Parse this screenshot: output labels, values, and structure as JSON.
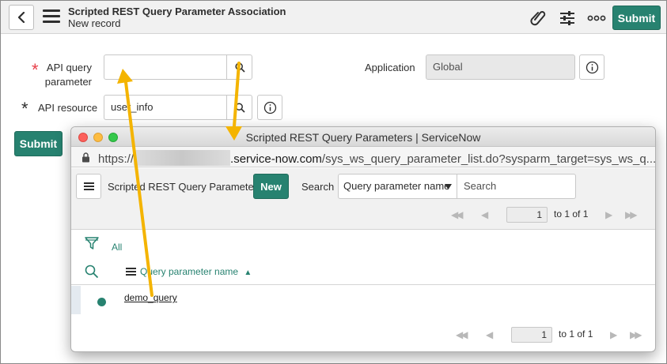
{
  "header": {
    "title": "Scripted REST Query Parameter Association",
    "subtitle": "New record",
    "submit_label": "Submit",
    "icons": [
      "back-icon",
      "menu-icon",
      "attachment-icon",
      "settings-sliders-icon",
      "more-icon"
    ]
  },
  "form": {
    "api_query_parameter": {
      "label": "API query parameter",
      "label_line1": "API query",
      "label_line2": "parameter",
      "value": "",
      "required": true
    },
    "api_resource": {
      "label": "API resource",
      "value": "user_info",
      "required": true
    },
    "application": {
      "label": "Application",
      "value": "Global"
    },
    "submit_label": "Submit"
  },
  "popup": {
    "window_title": "Scripted REST Query Parameters | ServiceNow",
    "url_prefix": "https://",
    "url_host": ".service-now.com",
    "url_path": "/sys_ws_query_parameter_list.do?sysparm_target=sys_ws_q...",
    "list_title": "Scripted REST Query Parameters",
    "new_label": "New",
    "search_label": "Search",
    "search_field_selected": "Query parameter name",
    "search_placeholder": "Search",
    "pager": {
      "current": "1",
      "text": "to 1 of 1"
    },
    "filter_label": "All",
    "column_header": "Query parameter name",
    "sort_indicator": "▲",
    "rows": [
      "demo_query"
    ]
  },
  "colors": {
    "accent": "#278270",
    "required_star": "#e8404a",
    "annotation_arrow": "#f4b400"
  }
}
